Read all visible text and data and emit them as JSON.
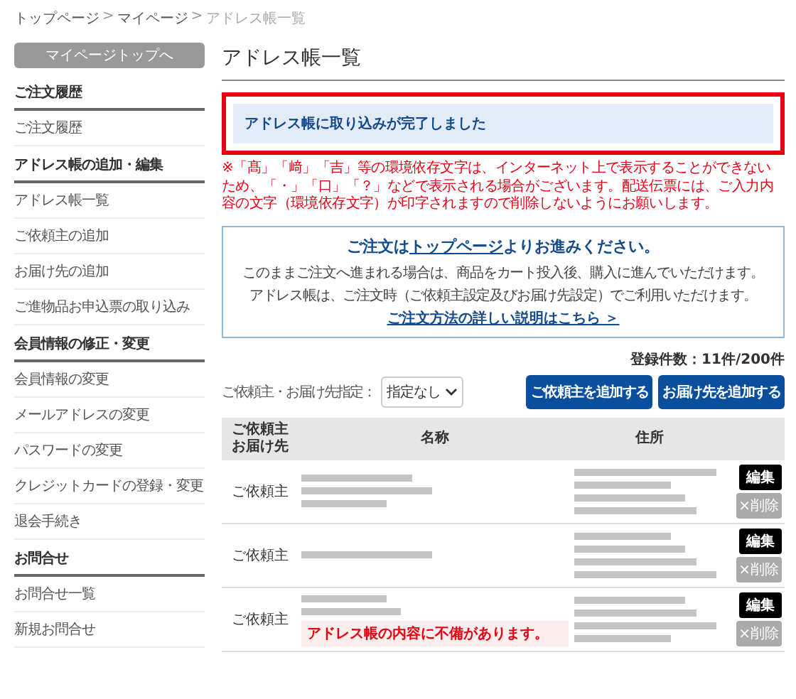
{
  "breadcrumb": {
    "separator": ">",
    "items": [
      {
        "label": "トップページ",
        "current": false
      },
      {
        "label": "マイページ",
        "current": false
      },
      {
        "label": "アドレス帳一覧",
        "current": true
      }
    ]
  },
  "sidebar": {
    "top_button": "マイページトップへ",
    "sections": [
      {
        "title": "ご注文履歴",
        "items": [
          "ご注文履歴"
        ]
      },
      {
        "title": "アドレス帳の追加・編集",
        "items": [
          "アドレス帳一覧",
          "ご依頼主の追加",
          "お届け先の追加",
          "ご進物品お申込票の取り込み"
        ]
      },
      {
        "title": "会員情報の修正・変更",
        "items": [
          "会員情報の変更",
          "メールアドレスの変更",
          "パスワードの変更",
          "クレジットカードの登録・変更",
          "退会手続き"
        ]
      },
      {
        "title": "お問合せ",
        "items": [
          "お問合せ一覧",
          "新規お問合せ"
        ]
      }
    ]
  },
  "main": {
    "title": "アドレス帳一覧",
    "alert": {
      "text": "アドレス帳に取り込みが完了しました",
      "highlighted": true
    },
    "notice": "※「髙」「﨑」「吉」等の環境依存文字は、インターネット上で表示することができないため、「・」「口」「？」などで表示される場合がございます。配送伝票には、ご入力内容の文字（環境依存文字）が印字されますので削除しないようにお願いします。",
    "info_box": {
      "heading_before": "ご注文は",
      "heading_link": "トップページ",
      "heading_after": "よりお進みください。",
      "lines": [
        "このままご注文へ進まれる場合は、商品をカート投入後、購入に進んでいただけます。",
        "アドレス帳は、ご注文時（ご依頼主設定及びお届け先設定）でご利用いただけます。"
      ],
      "link": "ご注文方法の詳しい説明はこちら ＞"
    },
    "count": "登録件数：11件/200件",
    "filter": {
      "label": "ご依頼主・お届け先指定：",
      "value": "指定なし"
    },
    "buttons": [
      "ご依頼主を追加する",
      "お届け先を追加する"
    ],
    "table": {
      "columns": [
        {
          "lines": [
            "ご依頼主",
            "お届け先"
          ]
        },
        {
          "lines": [
            "名称"
          ]
        },
        {
          "lines": [
            "住所"
          ]
        }
      ],
      "rows": [
        {
          "type": "ご依頼主",
          "name_blur": [
            {
              "kind": "redacted"
            },
            {
              "kind": "redacted"
            },
            {
              "kind": "redacted"
            }
          ],
          "address_blur": [
            {
              "kind": "redacted"
            },
            {
              "kind": "redacted"
            },
            {
              "kind": "redacted"
            },
            {
              "kind": "redacted"
            }
          ],
          "edit": "編集",
          "delete": "×削除",
          "delete_enabled": false
        },
        {
          "type": "ご依頼主",
          "name_blur": [
            {
              "kind": "redacted"
            }
          ],
          "address_blur": [
            {
              "kind": "redacted"
            },
            {
              "kind": "redacted"
            },
            {
              "kind": "redacted"
            },
            {
              "kind": "redacted"
            }
          ],
          "edit": "編集",
          "delete": "×削除",
          "delete_enabled": false
        },
        {
          "type": "ご依頼主",
          "name_blur": [
            {
              "kind": "redacted"
            },
            {
              "kind": "redacted"
            }
          ],
          "warning": "アドレス帳の内容に不備があります。",
          "address_blur": [
            {
              "kind": "redacted"
            },
            {
              "kind": "redacted"
            },
            {
              "kind": "redacted"
            },
            {
              "kind": "redacted"
            }
          ],
          "edit": "編集",
          "delete": "×削除",
          "delete_enabled": false
        }
      ]
    }
  }
}
